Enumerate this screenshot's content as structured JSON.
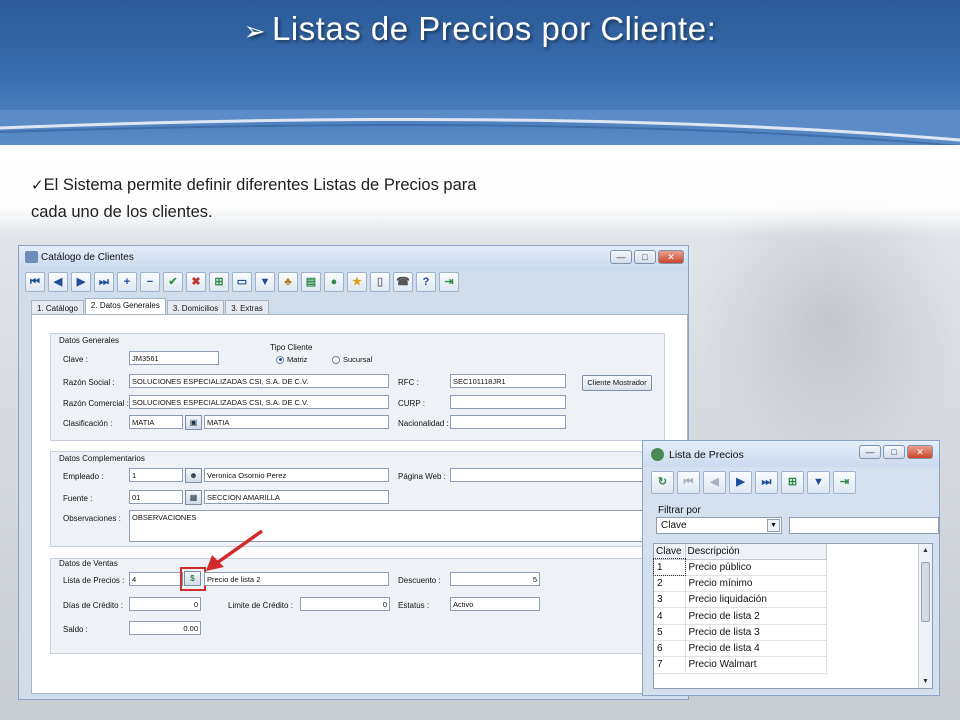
{
  "slide": {
    "title": "Listas de Precios por Cliente:",
    "title_bullet": "➢",
    "body_check": "✓",
    "body_text": "El Sistema permite definir diferentes Listas de Precios para cada uno de los clientes."
  },
  "main_window": {
    "title": "Catálogo de Clientes",
    "controls": {
      "minimize": "—",
      "maximize": "□",
      "close": "✕"
    },
    "toolbar": [
      "first-icon",
      "prev-icon",
      "next-icon",
      "last-icon",
      "add-icon",
      "remove-icon",
      "accept-icon",
      "cancel-icon",
      "export-icon",
      "window-icon",
      "filter-icon",
      "users-icon",
      "report-icon",
      "globe-icon",
      "folder-icon",
      "document-icon",
      "contact-icon",
      "help-icon",
      "exit-icon"
    ],
    "tabs": [
      "1. Catálogo",
      "2. Datos Generales",
      "3. Domicilios",
      "3. Extras"
    ],
    "active_tab": "2. Datos Generales",
    "datos_generales": {
      "group_label": "Datos Generales",
      "clave_label": "Clave :",
      "clave_value": "JM3561",
      "tipo_cliente_label": "Tipo Cliente",
      "matriz_label": "Matriz",
      "sucursal_label": "Sucursal",
      "selected_tipo": "Matriz",
      "razon_social_label": "Razón Social :",
      "razon_social_value": "SOLUCIONES ESPECIALIZADAS CSI, S.A. DE C.V.",
      "rfc_label": "RFC :",
      "rfc_value": "SEC101118JR1",
      "cliente_mostrador_label": "Cliente Mostrador",
      "razon_comercial_label": "Razón Comercial :",
      "razon_comercial_value": "SOLUCIONES ESPECIALIZADAS CSI, S.A. DE C.V.",
      "curp_label": "CURP :",
      "curp_value": "",
      "clasificacion_label": "Clasificación :",
      "clasificacion_code": "MATIA",
      "clasificacion_desc": "MATIA",
      "nacionalidad_label": "Nacionalidad :",
      "nacionalidad_value": ""
    },
    "datos_complementarios": {
      "group_label": "Datos Complementarios",
      "empleado_label": "Empleado :",
      "empleado_code": "1",
      "empleado_name": "Veronica Osornio Perez",
      "pagina_web_label": "Página Web :",
      "pagina_web_value": "",
      "fuente_label": "Fuente :",
      "fuente_code": "01",
      "fuente_desc": "SECCION AMARILLA",
      "observaciones_label": "Observaciones :",
      "observaciones_value": "OBSERVACIONES"
    },
    "datos_ventas": {
      "group_label": "Datos de Ventas",
      "lista_precios_label": "Lista de Precios :",
      "lista_precios_code": "4",
      "lista_precios_desc": "Precio de lista 2",
      "descuento_label": "Descuento :",
      "descuento_value": "5",
      "dias_credito_label": "Días de Crédito :",
      "dias_credito_value": "0",
      "limite_credito_label": "Limite de Crédito :",
      "limite_credito_value": "0",
      "estatus_label": "Estatus :",
      "estatus_value": "Activo",
      "saldo_label": "Saldo :",
      "saldo_value": "0.00"
    }
  },
  "popup": {
    "title": "Lista de Precios",
    "toolbar": [
      "refresh-icon",
      "first-icon",
      "prev-icon",
      "next-icon",
      "last-icon",
      "export-icon",
      "filter-icon",
      "exit-icon"
    ],
    "filter_label": "Filtrar por",
    "filter_field": "Clave",
    "filter_value": "",
    "columns": [
      "Clave",
      "Descripción"
    ],
    "rows": [
      [
        "1",
        "Precio público"
      ],
      [
        "2",
        "Precio mínimo"
      ],
      [
        "3",
        "Precio liquidación"
      ],
      [
        "4",
        "Precio de lista 2"
      ],
      [
        "5",
        "Precio de lista 3"
      ],
      [
        "6",
        "Precio de lista 4"
      ],
      [
        "7",
        "Precio Walmart"
      ]
    ]
  },
  "colors": {
    "header_blue": "#2a5a97",
    "highlight_red": "#d12a2a",
    "window_frame": "#cfdcec"
  }
}
